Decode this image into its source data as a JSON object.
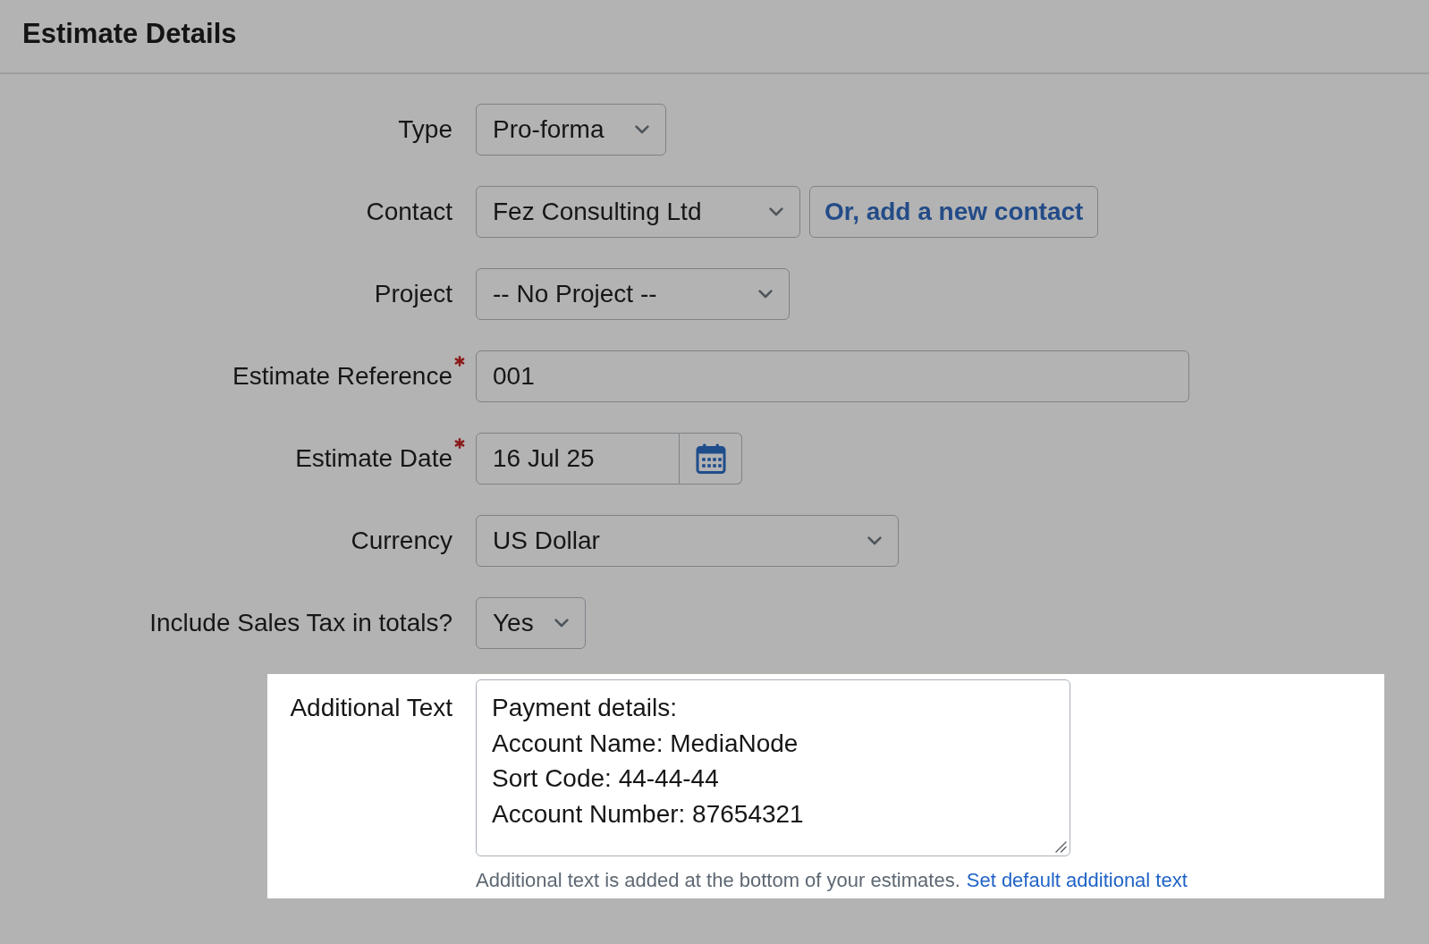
{
  "header": {
    "title": "Estimate Details"
  },
  "fields": [
    {
      "kind": "select",
      "label": "Type",
      "value": "Pro-forma",
      "required": false,
      "highlighted": false
    },
    {
      "kind": "select",
      "label": "Contact",
      "value": "Fez Consulting Ltd",
      "required": false,
      "highlighted": false,
      "action": "Or, add a new contact"
    },
    {
      "kind": "select",
      "label": "Project",
      "value": "-- No Project --",
      "required": false,
      "highlighted": false
    },
    {
      "kind": "text",
      "label": "Estimate Reference",
      "value": "001",
      "required": true,
      "highlighted": false
    },
    {
      "kind": "date",
      "label": "Estimate Date",
      "value": "16 Jul 25",
      "required": true,
      "highlighted": false
    },
    {
      "kind": "select",
      "label": "Currency",
      "value": "US Dollar",
      "required": false,
      "highlighted": false
    },
    {
      "kind": "select",
      "label": "Include Sales Tax in totals?",
      "value": "Yes",
      "required": false,
      "highlighted": false
    },
    {
      "kind": "textarea",
      "label": "Additional Text",
      "value": "Payment details:\nAccount Name: MediaNode\nSort Code: 44-44-44\nAccount Number: 87654321",
      "required": false,
      "highlighted": true,
      "help": "Additional text is added at the bottom of your estimates.",
      "help_link": "Set default additional text"
    }
  ]
}
